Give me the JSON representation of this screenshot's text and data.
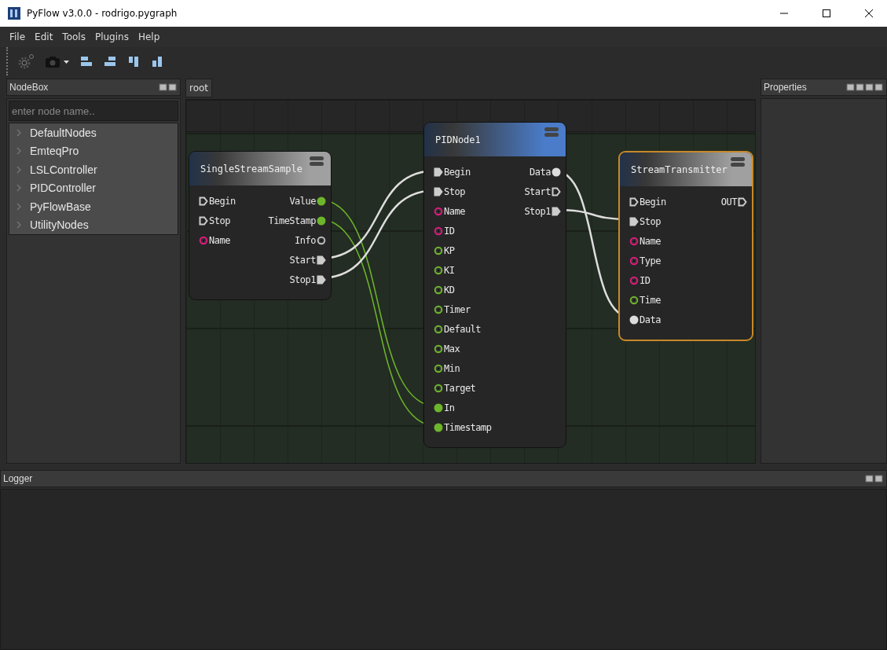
{
  "window": {
    "title": "PyFlow v3.0.0 - rodrigo.pygraph"
  },
  "menu": [
    "File",
    "Edit",
    "Tools",
    "Plugins",
    "Help"
  ],
  "nodebox": {
    "title": "NodeBox",
    "search": {
      "placeholder": "enter node name.."
    },
    "items": [
      {
        "label": "DefaultNodes",
        "expanded": false
      },
      {
        "label": "EmteqPro",
        "expanded": false
      },
      {
        "label": "LSLController",
        "expanded": false
      },
      {
        "label": "PIDController",
        "expanded": false
      },
      {
        "label": "PyFlowBase",
        "expanded": false
      },
      {
        "label": "UtilityNodes",
        "expanded": false
      }
    ]
  },
  "graph_tab": "root",
  "nodes": [
    {
      "title": "SingleStreamSample",
      "color": "#a0a0a0",
      "selected": false,
      "inputs": [
        {
          "label": "Begin",
          "kind": "exec",
          "connected": false,
          "color": "#cccccc"
        },
        {
          "label": "Stop",
          "kind": "exec",
          "connected": false,
          "color": "#cccccc"
        },
        {
          "label": "Name",
          "kind": "data",
          "connected": false,
          "color": "#e0197d"
        }
      ],
      "outputs": [
        {
          "label": "Value",
          "kind": "data",
          "connected": true,
          "color": "#6db52a"
        },
        {
          "label": "TimeStamp",
          "kind": "data",
          "connected": true,
          "color": "#6db52a"
        },
        {
          "label": "Info",
          "kind": "data",
          "connected": false,
          "color": "#bbbbbb"
        },
        {
          "label": "Start",
          "kind": "exec",
          "connected": true,
          "color": "#cccccc"
        },
        {
          "label": "Stop1",
          "kind": "exec",
          "connected": true,
          "color": "#cccccc"
        }
      ]
    },
    {
      "title": "PIDNode1",
      "color": "#4a7cc9",
      "selected": false,
      "inputs": [
        {
          "label": "Begin",
          "kind": "exec",
          "connected": true,
          "color": "#cccccc"
        },
        {
          "label": "Stop",
          "kind": "exec",
          "connected": true,
          "color": "#cccccc"
        },
        {
          "label": "Name",
          "kind": "data",
          "connected": false,
          "color": "#e0197d"
        },
        {
          "label": "ID",
          "kind": "data",
          "connected": false,
          "color": "#e0197d"
        },
        {
          "label": "KP",
          "kind": "data",
          "connected": false,
          "color": "#6db52a"
        },
        {
          "label": "KI",
          "kind": "data",
          "connected": false,
          "color": "#6db52a"
        },
        {
          "label": "KD",
          "kind": "data",
          "connected": false,
          "color": "#6db52a"
        },
        {
          "label": "Timer",
          "kind": "data",
          "connected": false,
          "color": "#6db52a"
        },
        {
          "label": "Default",
          "kind": "data",
          "connected": false,
          "color": "#6db52a"
        },
        {
          "label": "Max",
          "kind": "data",
          "connected": false,
          "color": "#6db52a"
        },
        {
          "label": "Min",
          "kind": "data",
          "connected": false,
          "color": "#6db52a"
        },
        {
          "label": "Target",
          "kind": "data",
          "connected": false,
          "color": "#6db52a"
        },
        {
          "label": "In",
          "kind": "data",
          "connected": true,
          "color": "#6db52a"
        },
        {
          "label": "Timestamp",
          "kind": "data",
          "connected": true,
          "color": "#6db52a"
        }
      ],
      "outputs": [
        {
          "label": "Data",
          "kind": "data",
          "connected": true,
          "color": "#dddddd"
        },
        {
          "label": "Start",
          "kind": "exec",
          "connected": false,
          "color": "#cccccc"
        },
        {
          "label": "Stop1",
          "kind": "exec",
          "connected": true,
          "color": "#cccccc"
        }
      ]
    },
    {
      "title": "StreamTransmitter",
      "color": "#a0a0a0",
      "selected": true,
      "inputs": [
        {
          "label": "Begin",
          "kind": "exec",
          "connected": false,
          "color": "#cccccc"
        },
        {
          "label": "Stop",
          "kind": "exec",
          "connected": true,
          "color": "#cccccc"
        },
        {
          "label": "Name",
          "kind": "data",
          "connected": false,
          "color": "#e0197d"
        },
        {
          "label": "Type",
          "kind": "data",
          "connected": false,
          "color": "#e0197d"
        },
        {
          "label": "ID",
          "kind": "data",
          "connected": false,
          "color": "#e0197d"
        },
        {
          "label": "Time",
          "kind": "data",
          "connected": false,
          "color": "#6db52a"
        },
        {
          "label": "Data",
          "kind": "data",
          "connected": true,
          "color": "#dddddd"
        }
      ],
      "outputs": [
        {
          "label": "OUT",
          "kind": "exec",
          "connected": false,
          "color": "#cccccc"
        }
      ]
    }
  ],
  "properties": {
    "title": "Properties"
  },
  "logger": {
    "title": "Logger"
  }
}
